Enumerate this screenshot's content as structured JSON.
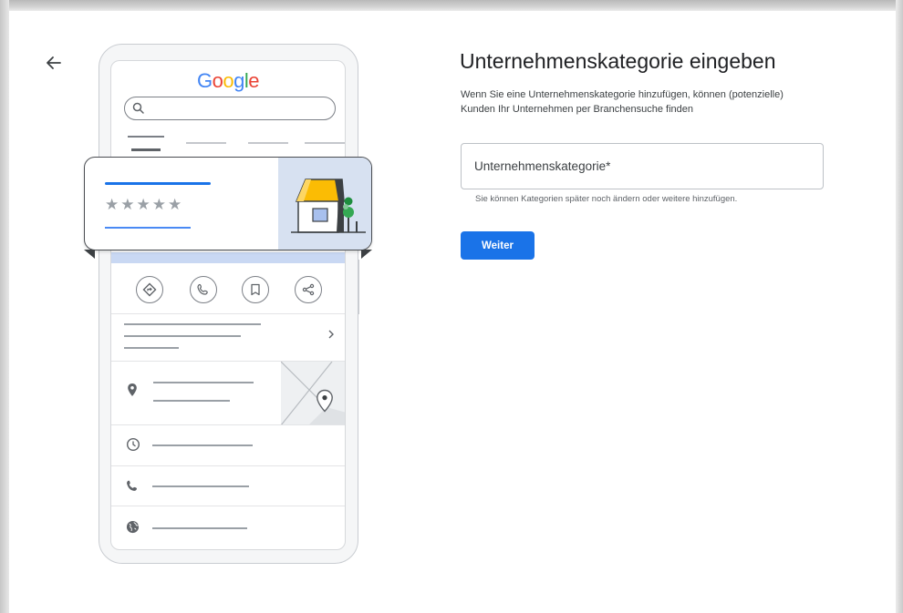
{
  "logo": {
    "text": "Google",
    "letter_colors": [
      "#4285f4",
      "#ea4335",
      "#fbbc05",
      "#4285f4",
      "#34a853",
      "#ea4335"
    ]
  },
  "page": {
    "title": "Unternehmenskategorie eingeben",
    "description": "Wenn Sie eine Unternehmenskategorie hinzufügen, können (potenzielle) Kunden Ihr Unternehmen per Branchensuche finden",
    "category_field": {
      "placeholder": "Unternehmenskategorie*",
      "value": ""
    },
    "hint": "Sie können Kategorien später noch ändern oder weitere hinzufügen.",
    "next_button": "Weiter"
  },
  "mock_card": {
    "stars": "★★★★★"
  },
  "colors": {
    "accent": "#1a73e8",
    "awning_yellow": "#fbbc04"
  },
  "icons": {
    "back": "arrow-left-icon",
    "actions": [
      "directions-icon",
      "phone-icon",
      "bookmark-icon",
      "share-icon"
    ],
    "info_rows": [
      "location-pin-icon",
      "clock-icon",
      "phone-icon",
      "globe-icon"
    ]
  }
}
